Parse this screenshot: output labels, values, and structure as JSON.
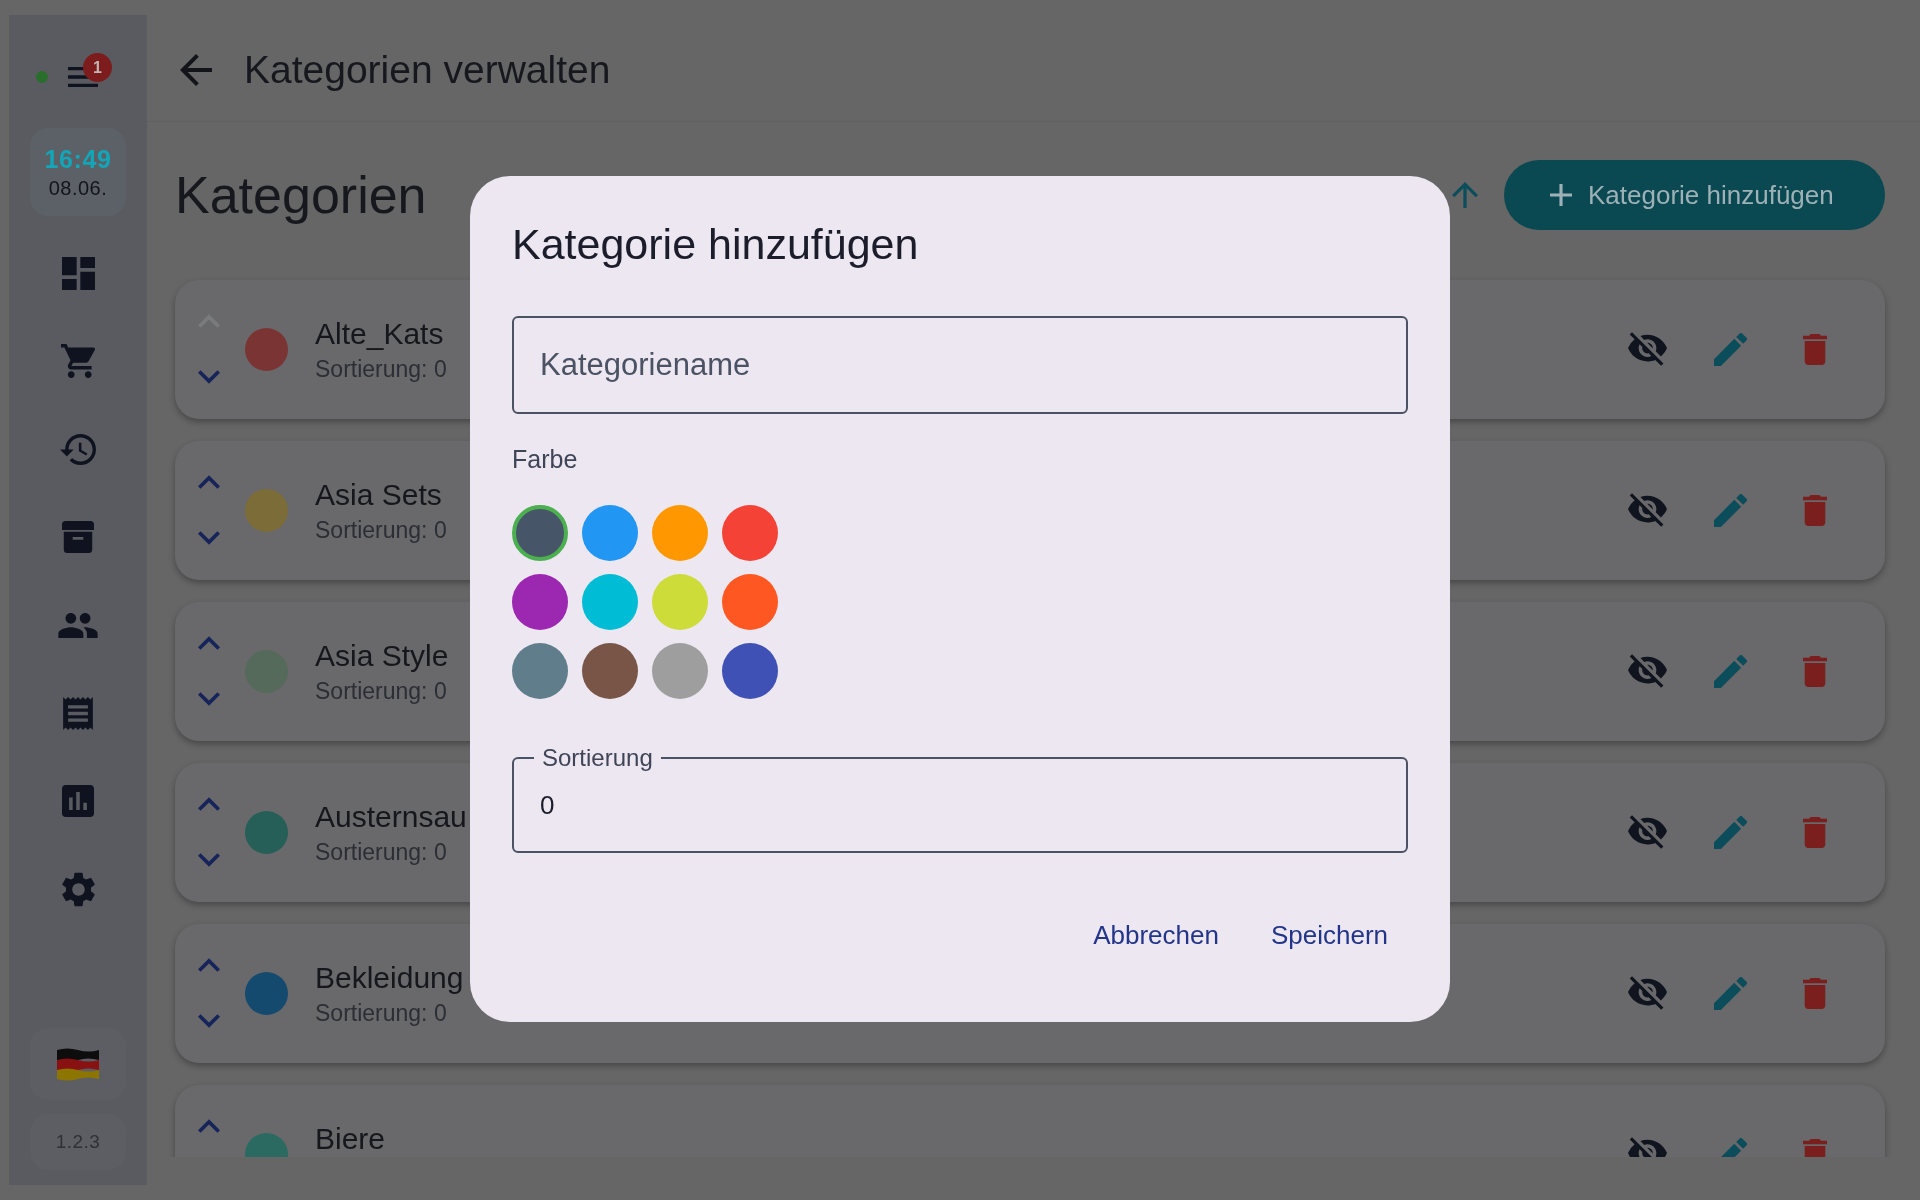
{
  "sidebar": {
    "connected": true,
    "menu_badge": "1",
    "time": "16:49",
    "date": "08.06.",
    "version": "1.2.3"
  },
  "header": {
    "title": "Kategorien verwalten"
  },
  "page": {
    "heading": "Kategorien",
    "add_button": "Kategorie hinzufügen"
  },
  "rows": [
    {
      "kind": "full",
      "name": "Alte_Kats",
      "sort_label": "Sortierung: 0",
      "color": "#7b3434",
      "move_up_disabled": true
    },
    {
      "kind": "full",
      "name": "Asia Sets",
      "sort_label": "Sortierung: 0",
      "color": "#7c6c38",
      "move_up_disabled": false
    },
    {
      "kind": "full",
      "name": "Asia Style",
      "sort_label": "Sortierung: 0",
      "color": "#566a5c",
      "move_up_disabled": false
    },
    {
      "kind": "full",
      "name": "Austernsau",
      "sort_label": "Sortierung: 0",
      "color": "#255f57",
      "move_up_disabled": false
    },
    {
      "kind": "full",
      "name": "Bekleidung",
      "sort_label": "Sortierung: 0",
      "color": "#144a6e",
      "move_up_disabled": false
    },
    {
      "kind": "cut",
      "name": "Biere",
      "color": "#2a6a60",
      "move_up_disabled": false
    }
  ],
  "dialog": {
    "title": "Kategorie hinzufügen",
    "name_field": {
      "placeholder": "Kategoriename"
    },
    "color_label": "Farbe",
    "colors": [
      {
        "color": "#475569",
        "selected": true
      },
      {
        "color": "#2196f3",
        "selected": false
      },
      {
        "color": "#ff9800",
        "selected": false
      },
      {
        "color": "#f44336",
        "selected": false
      },
      {
        "color": "#9c27b0",
        "selected": false
      },
      {
        "color": "#00bcd4",
        "selected": false
      },
      {
        "color": "#cddc39",
        "selected": false
      },
      {
        "color": "#ff5722",
        "selected": false
      },
      {
        "color": "#607d8b",
        "selected": false
      },
      {
        "color": "#795548",
        "selected": false
      },
      {
        "color": "#9e9e9e",
        "selected": false
      },
      {
        "color": "#3f51b5",
        "selected": false
      }
    ],
    "sort_field": {
      "label": "Sortierung",
      "value": "0"
    },
    "buttons": [
      {
        "label": "Abbrechen"
      },
      {
        "label": "Speichern"
      }
    ]
  }
}
